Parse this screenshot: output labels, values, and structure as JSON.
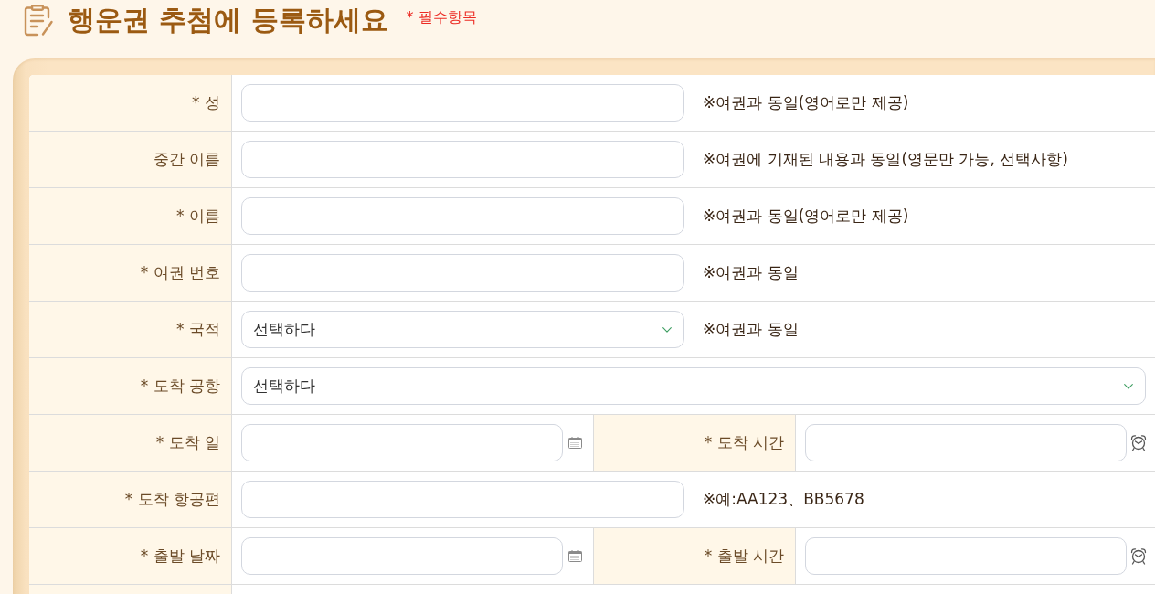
{
  "header": {
    "title": "행운권 추첨에 등록하세요",
    "required_note": "* 필수항목"
  },
  "form": {
    "rows": [
      {
        "kind": "text",
        "label": "* 성",
        "note": "※여권과 동일(영어로만 제공)"
      },
      {
        "kind": "text",
        "label": "중간 이름",
        "note": "※여권에 기재된 내용과 동일(영문만 가능, 선택사항)"
      },
      {
        "kind": "text",
        "label": "* 이름",
        "note": "※여권과 동일(영어로만 제공)"
      },
      {
        "kind": "text",
        "label": "* 여권 번호",
        "note": "※여권과 동일"
      },
      {
        "kind": "select",
        "label": "* 국적",
        "value": "선택하다",
        "note": "※여권과 동일"
      },
      {
        "kind": "select_wide",
        "label": "* 도착 공항",
        "value": "선택하다"
      },
      {
        "kind": "date_time",
        "label": "* 도착 일",
        "time_label": "* 도착 시간"
      },
      {
        "kind": "text",
        "label": "* 도착 항공편",
        "note": "※예:AA123、BB5678"
      },
      {
        "kind": "date_time",
        "label": "* 출발 날짜",
        "time_label": "* 출발 시간"
      }
    ]
  }
}
